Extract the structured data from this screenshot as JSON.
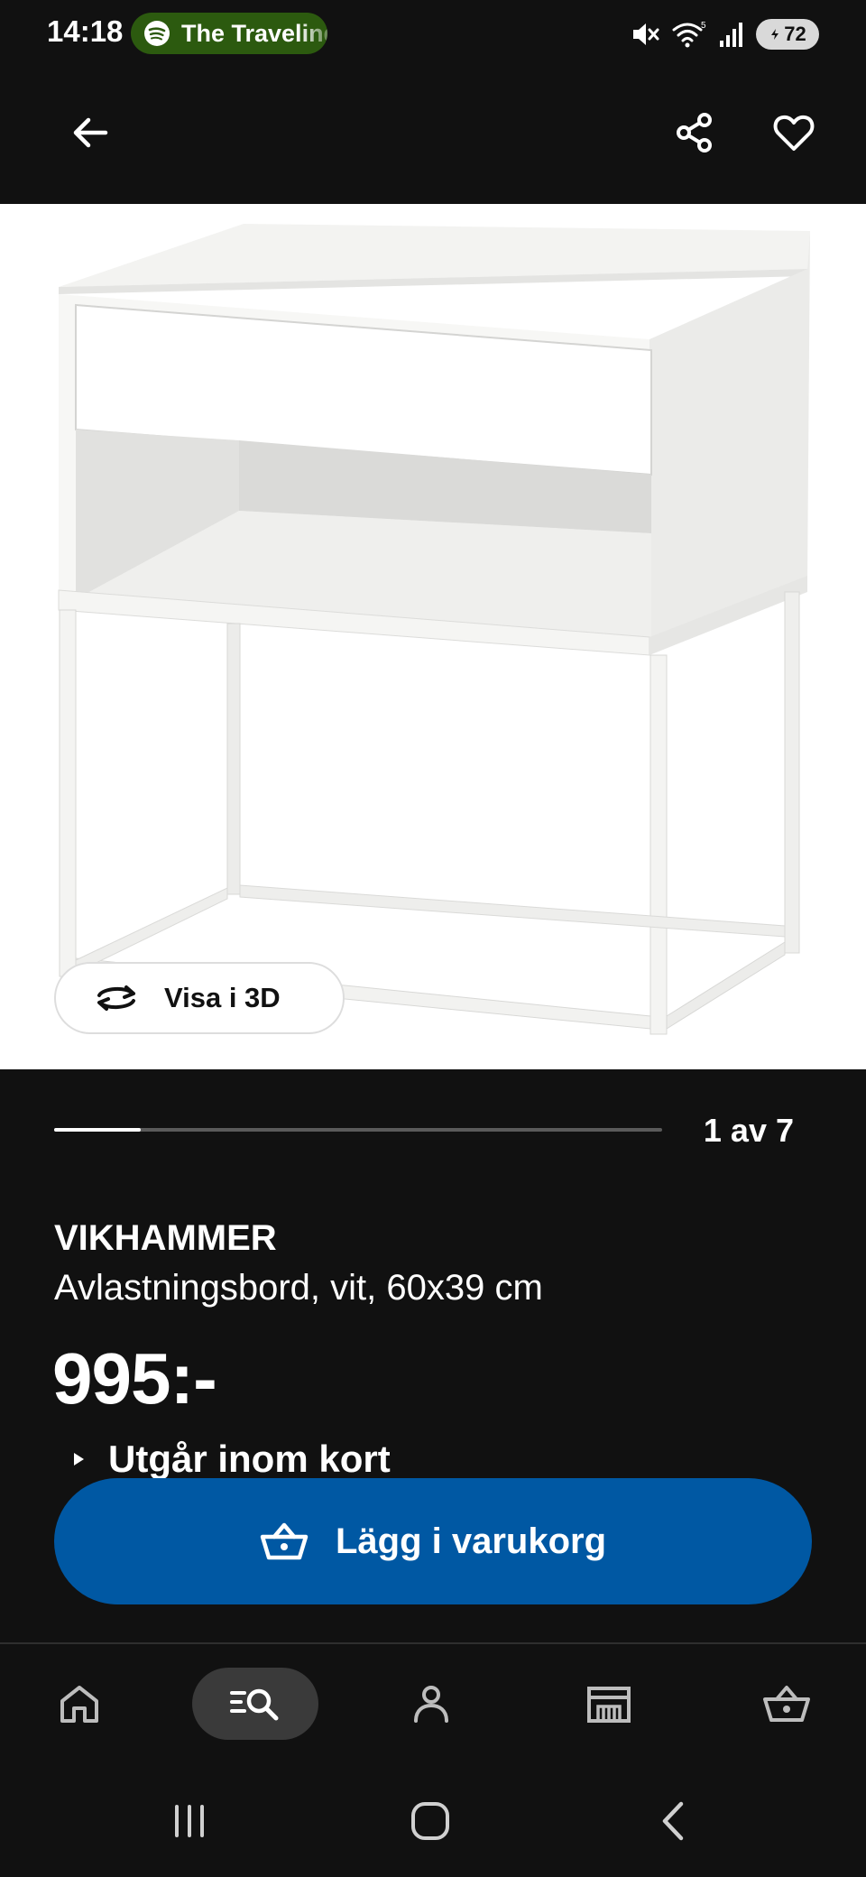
{
  "status_bar": {
    "time": "14:18",
    "media_text": "The Traveling",
    "battery": "72",
    "icons": [
      "spotify-icon",
      "mute-icon",
      "wifi-icon",
      "signal-icon",
      "battery-icon"
    ]
  },
  "app_bar": {
    "icons": [
      "back-arrow-icon",
      "share-icon",
      "heart-icon"
    ]
  },
  "product_image": {
    "view_3d_label": "Visa i 3D",
    "view_3d_icon": "rotate-icon"
  },
  "pager": {
    "text": "1 av 7",
    "current": 1,
    "total": 7
  },
  "product": {
    "name": "VIKHAMMER",
    "description": "Avlastningsbord, vit, 60x39 cm",
    "price": "995:-",
    "notice": "Utgår inom kort"
  },
  "cart": {
    "label": "Lägg i varukorg",
    "icon": "basket-icon"
  },
  "bottom_nav": {
    "items": [
      "home-icon",
      "search-icon",
      "profile-icon",
      "store-icon",
      "basket-icon"
    ],
    "active": "search-icon"
  },
  "system_nav": {
    "items": [
      "recents-icon",
      "home-icon",
      "back-icon"
    ]
  },
  "colors": {
    "background": "#111111",
    "accent_blue": "#0058a3",
    "media_pill": "#2c5a0f"
  }
}
